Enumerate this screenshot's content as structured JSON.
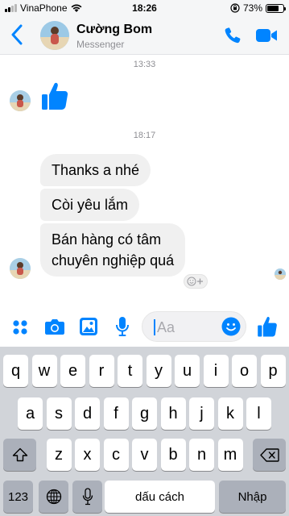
{
  "status_bar": {
    "carrier": "VinaPhone",
    "time": "18:26",
    "battery": "73%",
    "battery_level": 0.73
  },
  "header": {
    "name": "Cường Bom",
    "subtitle": "Messenger",
    "icons": [
      "back-chevron-icon",
      "phone-icon",
      "video-camera-icon"
    ]
  },
  "conversation": {
    "time_1": "13:33",
    "time_2": "18:17",
    "messages": [
      {
        "from": "contact",
        "type": "like-sticker"
      },
      {
        "from": "contact",
        "text": "Thanks a nhé"
      },
      {
        "from": "contact",
        "text": "Còi yêu lắm"
      },
      {
        "from": "contact",
        "text_line1": "Bán hàng có tâm",
        "text_line2": "chuyên nghiệp quá"
      }
    ]
  },
  "composer": {
    "placeholder": "Aa",
    "icons": [
      "apps-dots-icon",
      "camera-icon",
      "image-icon",
      "microphone-icon",
      "emoji-icon",
      "like-icon"
    ]
  },
  "keyboard": {
    "row1": [
      "q",
      "w",
      "e",
      "r",
      "t",
      "y",
      "u",
      "i",
      "o",
      "p"
    ],
    "row2": [
      "a",
      "s",
      "d",
      "f",
      "g",
      "h",
      "j",
      "k",
      "l"
    ],
    "row3": [
      "z",
      "x",
      "c",
      "v",
      "b",
      "n",
      "m"
    ],
    "numbers_label": "123",
    "space_label": "dấu cách",
    "return_label": "Nhập"
  },
  "colors": {
    "accent": "#0084ff",
    "bubble": "#f0f0f0",
    "keyboard_bg": "#d1d4d9"
  }
}
